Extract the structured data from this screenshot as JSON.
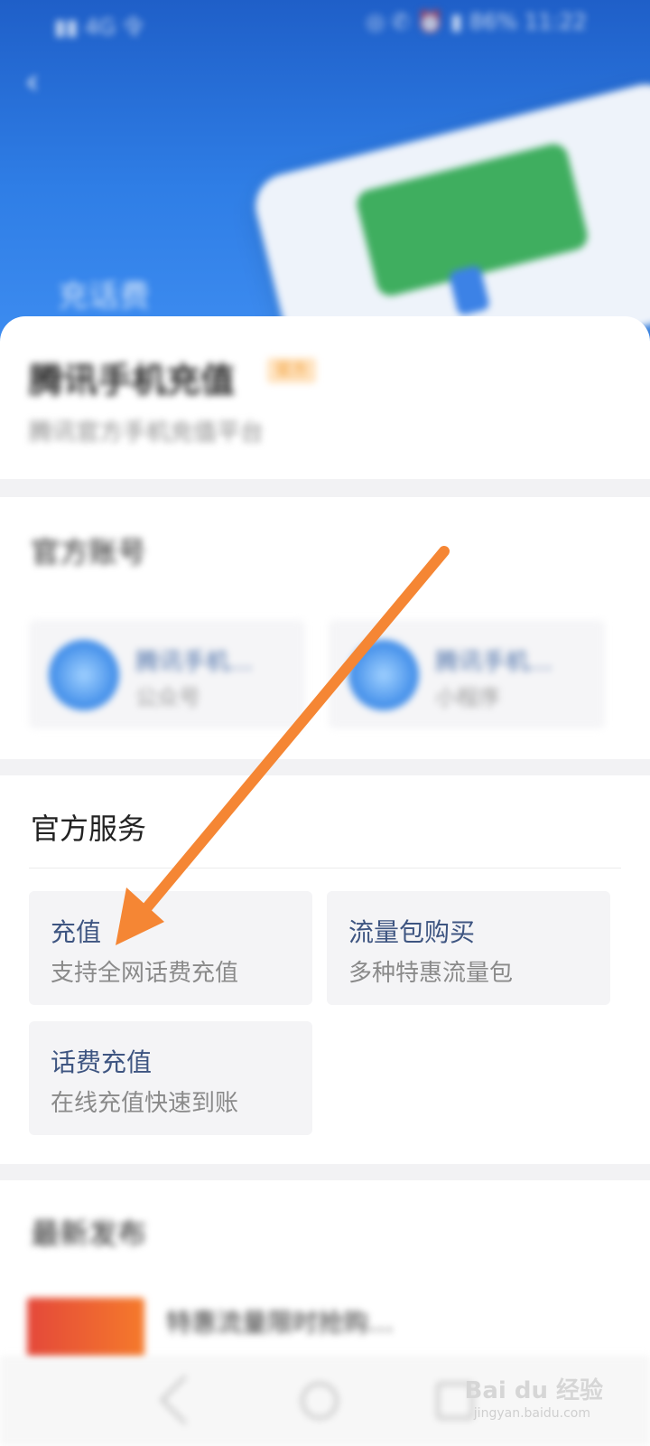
{
  "status_bar": {
    "left": "▮▮ 4G 令",
    "right": "◎ ✆ ⏰ ▮ 86% 11:22"
  },
  "nav": {
    "back_icon": "back-arrow-icon"
  },
  "hero": {
    "tag": "充话费"
  },
  "header": {
    "title": "腾讯手机充值",
    "badge": "官方",
    "subtitle": "腾讯官方手机充值平台"
  },
  "accounts": {
    "title": "官方账号",
    "items": [
      {
        "name": "腾讯手机…",
        "type": "公众号"
      },
      {
        "name": "腾讯手机…",
        "type": "小程序"
      }
    ]
  },
  "services": {
    "title": "官方服务",
    "items": [
      {
        "title": "充值",
        "desc": "支持全网话费充值"
      },
      {
        "title": "流量包购买",
        "desc": "多种特惠流量包"
      },
      {
        "title": "话费充值",
        "desc": "在线充值快速到账"
      }
    ]
  },
  "latest": {
    "title": "最新发布",
    "item_title": "特惠流量限时抢购…"
  },
  "watermark": {
    "brand": "Bai du 经验",
    "url": "jingyan.baidu.com"
  },
  "colors": {
    "accent": "#3e5581",
    "hero_blue": "#2f7ee6",
    "arrow": "#f58634"
  }
}
